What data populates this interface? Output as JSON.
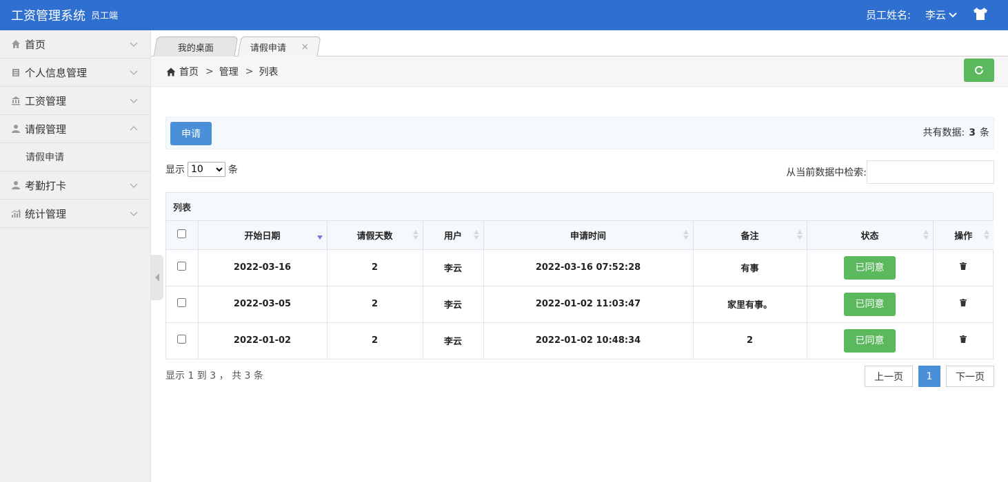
{
  "header": {
    "title": "工资管理系统",
    "subtitle": "员工端",
    "user_label": "员工姓名:",
    "user_name": "李云"
  },
  "sidebar": {
    "items": [
      {
        "label": "首页",
        "icon": "home-icon"
      },
      {
        "label": "个人信息管理",
        "icon": "clipboard-icon"
      },
      {
        "label": "工资管理",
        "icon": "bank-icon"
      },
      {
        "label": "请假管理",
        "icon": "user-icon",
        "expanded": true,
        "children": [
          {
            "label": "请假申请"
          }
        ]
      },
      {
        "label": "考勤打卡",
        "icon": "user-icon"
      },
      {
        "label": "统计管理",
        "icon": "chart-icon"
      }
    ]
  },
  "tabs": [
    {
      "label": "我的桌面"
    },
    {
      "label": "请假申请",
      "active": true,
      "close": "×"
    }
  ],
  "breadcrumb": {
    "home": "首页",
    "sep": ">",
    "level2": "管理",
    "level3": "列表"
  },
  "toolbar": {
    "apply_label": "申请",
    "total_prefix": "共有数据:",
    "total_count": "3",
    "total_suffix": "条"
  },
  "length": {
    "prefix": "显示",
    "value": "10",
    "suffix": "条"
  },
  "search": {
    "label": "从当前数据中检索:"
  },
  "table": {
    "title": "列表",
    "columns": [
      "开始日期",
      "请假天数",
      "用户",
      "申请时间",
      "备注",
      "状态",
      "操作"
    ],
    "rows": [
      {
        "start": "2022-03-16",
        "days": "2",
        "user": "李云",
        "time": "2022-03-16 07:52:28",
        "note": "有事",
        "status": "已同意"
      },
      {
        "start": "2022-03-05",
        "days": "2",
        "user": "李云",
        "time": "2022-01-02 11:03:47",
        "note": "家里有事。",
        "status": "已同意"
      },
      {
        "start": "2022-01-02",
        "days": "2",
        "user": "李云",
        "time": "2022-01-02 10:48:34",
        "note": "2",
        "status": "已同意"
      }
    ]
  },
  "footer": {
    "info": "显示 1 到 3 ， 共 3 条",
    "prev": "上一页",
    "current": "1",
    "next": "下一页"
  },
  "colors": {
    "header_bg": "#2f6fcf",
    "primary": "#4a90d9",
    "success": "#5cb85c"
  }
}
